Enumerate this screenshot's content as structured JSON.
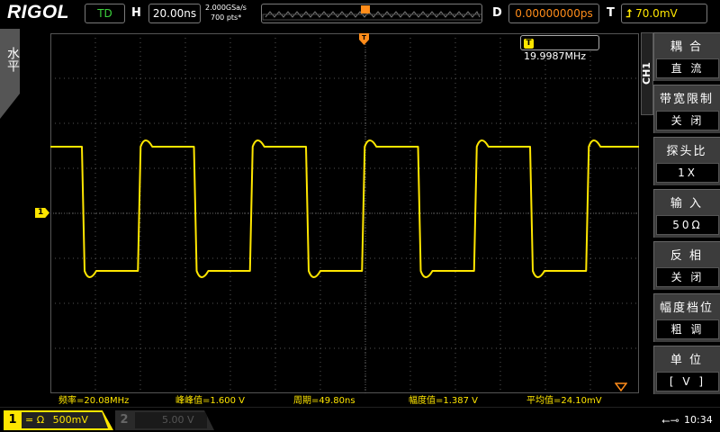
{
  "top_bar": {
    "brand": "RIGOL",
    "trigger_status": "TD",
    "horizontal_label": "H",
    "timebase": "20.00ns",
    "sample_rate": "2.000GSa/s",
    "memory_depth": "700 pts*",
    "delay_label": "D",
    "delay_value": "0.00000000ps",
    "trigger_label": "T",
    "trigger_level": "70.0mV",
    "trigger_edge_icon": "rising-edge-icon"
  },
  "left_tab": {
    "label": "水平"
  },
  "display": {
    "frequency_counter_badge": "T",
    "frequency_counter": "19.9987MHz",
    "channel_marker": "1",
    "trace_color": "#ffe600"
  },
  "waveform": {
    "type": "square",
    "period_ns": 49.8,
    "vertical_scale": "500mV/div",
    "timebase": "20ns/div"
  },
  "measurements": [
    {
      "label": "频率",
      "value": "20.08MHz"
    },
    {
      "label": "峰峰值",
      "value": "1.600 V"
    },
    {
      "label": "周期",
      "value": "49.80ns"
    },
    {
      "label": "幅度值",
      "value": "1.387 V"
    },
    {
      "label": "平均值",
      "value": "24.10mV"
    }
  ],
  "measurement_text": [
    "频率=20.08MHz",
    "峰峰值=1.600 V",
    "周期=49.80ns",
    "幅度值=1.387 V",
    "平均值=24.10mV"
  ],
  "bottom_bar": {
    "ch1_num": "1",
    "ch1_coupling": "=",
    "ch1_impedance": "Ω",
    "ch1_scale": "500mV",
    "ch2_num": "2",
    "ch2_scale": "5.00 V",
    "time": "10:34"
  },
  "menu": {
    "channel_tab": "CH1",
    "items": [
      {
        "title": "耦  合",
        "value": "直  流"
      },
      {
        "title": "带宽限制",
        "value": "关  闭"
      },
      {
        "title": "探头比",
        "value": "1X"
      },
      {
        "title": "输  入",
        "value": "50Ω"
      },
      {
        "title": "反  相",
        "value": "关  闭"
      },
      {
        "title": "幅度档位",
        "value": "粗  调"
      },
      {
        "title": "单  位",
        "value": "[  V  ]"
      }
    ]
  },
  "colors": {
    "trace": "#ffe600",
    "delay": "#ff8c1a",
    "trigger_status": "#3cd23c",
    "menu_arrow": "#ffb300"
  }
}
